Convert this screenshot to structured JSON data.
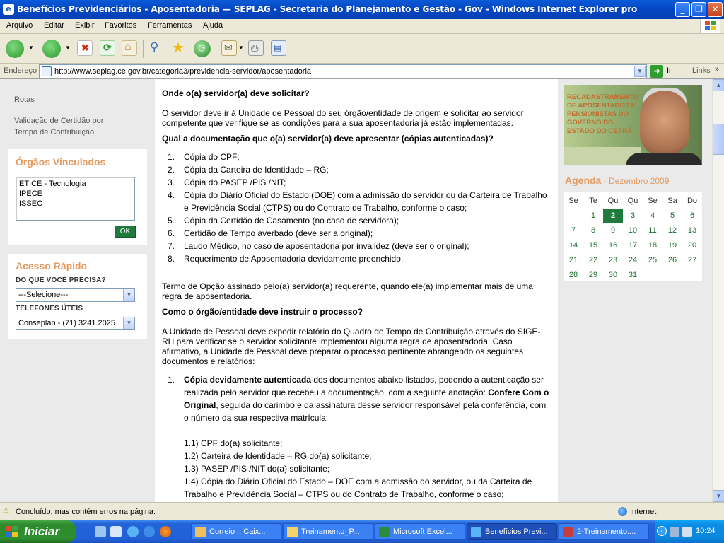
{
  "window": {
    "title": "Benefícios Previdenciários - Aposentadoria — SEPLAG - Secretaria do Planejamento e Gestão - Gov - Windows Internet Explorer pro"
  },
  "menu": [
    "Arquivo",
    "Editar",
    "Exibir",
    "Favoritos",
    "Ferramentas",
    "Ajuda"
  ],
  "toolbar_icons": [
    "back-icon",
    "dropdown-icon",
    "forward-icon",
    "dropdown-icon",
    "stop-icon",
    "refresh-icon",
    "home-icon",
    "search-icon",
    "favorites-star-icon",
    "history-icon",
    "mail-icon",
    "print-icon",
    "edit-icon"
  ],
  "address": {
    "label": "Endereço",
    "url": "http://www.seplag.ce.gov.br/categoria3/previdencia-servidor/aposentadoria",
    "go_label": "Ir",
    "links_label": "Links"
  },
  "sidebar": {
    "links": [
      "Rotas",
      "Validação de Certidão por Tempo de Contribuição"
    ],
    "orgaos": {
      "title": "Órgãos Vinculados",
      "items": [
        "ETICE - Tecnologia",
        "IPECE",
        "ISSEC"
      ],
      "ok_label": "OK"
    },
    "acesso": {
      "title": "Acesso Rápido",
      "q_label": "DO QUE VOCÊ PRECISA?",
      "q_value": "---Selecione---",
      "tel_label": "TELEFONES ÚTEIS",
      "tel_value": "Conseplan - (71) 3241.2025"
    }
  },
  "main": {
    "h_onde": "Onde o(a) servidor(a) deve solicitar?",
    "p_onde": "O servidor deve ir à Unidade de Pessoal do seu órgão/entidade de origem e solicitar ao servidor competente que verifique se as condições para a sua aposentadoria já estão implementadas.",
    "h_doc": "Qual a documentação que o(a) servidor(a) deve apresentar (cópias autenticadas)?",
    "docs": [
      {
        "n": "1.",
        "t": "Cópia do CPF;"
      },
      {
        "n": "2.",
        "t": "Cópia da Carteira de Identidade – RG;"
      },
      {
        "n": "3.",
        "t": "Cópia do PASEP /PIS /NIT;"
      },
      {
        "n": "4.",
        "t": "Cópia do Diário Oficial do Estado (DOE) com a admissão do servidor ou da Carteira de Trabalho e Previdência Social (CTPS) ou do Contrato de Trabalho, conforme o caso;"
      },
      {
        "n": "5.",
        "t": "Cópia da Certidão de Casamento (no caso de servidora);"
      },
      {
        "n": "6.",
        "t": "Certidão de Tempo averbado (deve ser a original);"
      },
      {
        "n": "7.",
        "t": "Laudo Médico, no caso de aposentadoria por invalidez (deve ser o original);"
      },
      {
        "n": "8.",
        "t": "Requerimento de Aposentadoria devidamente preenchido;"
      }
    ],
    "p_termo": "Termo de Opção assinado pelo(a) servidor(a) requerente, quando ele(a) implementar mais de uma regra de aposentadoria.",
    "h_como": "Como o órgão/entidade deve instruir o processo?",
    "p_como": "A Unidade de Pessoal deve expedir relatório do Quadro de Tempo de Contribuição através do SIGE-RH para verificar se o servidor solicitante implementou alguma regra de aposentadoria. Caso afirmativo, a Unidade de Pessoal deve preparar o processo pertinente abrangendo os seguintes documentos e relatórios:",
    "item1_num": "1.",
    "item1_bold": "Cópia devidamente autenticada",
    "item1_text1": " dos documentos abaixo listados, podendo a autenticação ser realizada pelo servidor que recebeu a documentação, com a seguinte anotação: ",
    "item1_bold2": "Confere Com o Original",
    "item1_text2": ", seguida do carimbo e da assinatura desse servidor responsável pela conferência, com o número da sua respectiva matrícula:",
    "sub": [
      "1.1) CPF do(a) solicitante;",
      "1.2) Carteira de Identidade – RG do(a) solicitante;",
      "1.3) PASEP /PIS /NIT do(a) solicitante;",
      "1.4) Cópia do Diário Oficial do Estado – DOE com a admissão do servidor, ou da Carteira de Trabalho e Previdência Social – CTPS ou do Contrato de Trabalho, conforme o caso;"
    ]
  },
  "right": {
    "banner_text": "RECADASTRAMENTO DE APOSENTADOS E PENSIONISTAS DO GOVERNO DO ESTADO DO CEARÁ.",
    "agenda_title": "Agenda",
    "agenda_month": " - Dezembro 2009",
    "weekdays": [
      "Se",
      "Te",
      "Qu",
      "Qu",
      "Se",
      "Sa",
      "Do"
    ],
    "weeks": [
      [
        "",
        "1",
        "2",
        "3",
        "4",
        "5",
        "6"
      ],
      [
        "7",
        "8",
        "9",
        "10",
        "11",
        "12",
        "13"
      ],
      [
        "14",
        "15",
        "16",
        "17",
        "18",
        "19",
        "20"
      ],
      [
        "21",
        "22",
        "23",
        "24",
        "25",
        "26",
        "27"
      ],
      [
        "28",
        "29",
        "30",
        "31",
        "",
        "",
        ""
      ]
    ],
    "today": "2"
  },
  "status": {
    "text": "Concluído, mas contém erros na página.",
    "zone": "Internet"
  },
  "taskbar": {
    "start": "Iniciar",
    "tasks": [
      "Correio :: Caix...",
      "Treinamento_P...",
      "Microsoft Excel...",
      "Benefícios Previ...",
      "2-Treinamento...."
    ],
    "active_task": 3,
    "clock": "10:24"
  }
}
